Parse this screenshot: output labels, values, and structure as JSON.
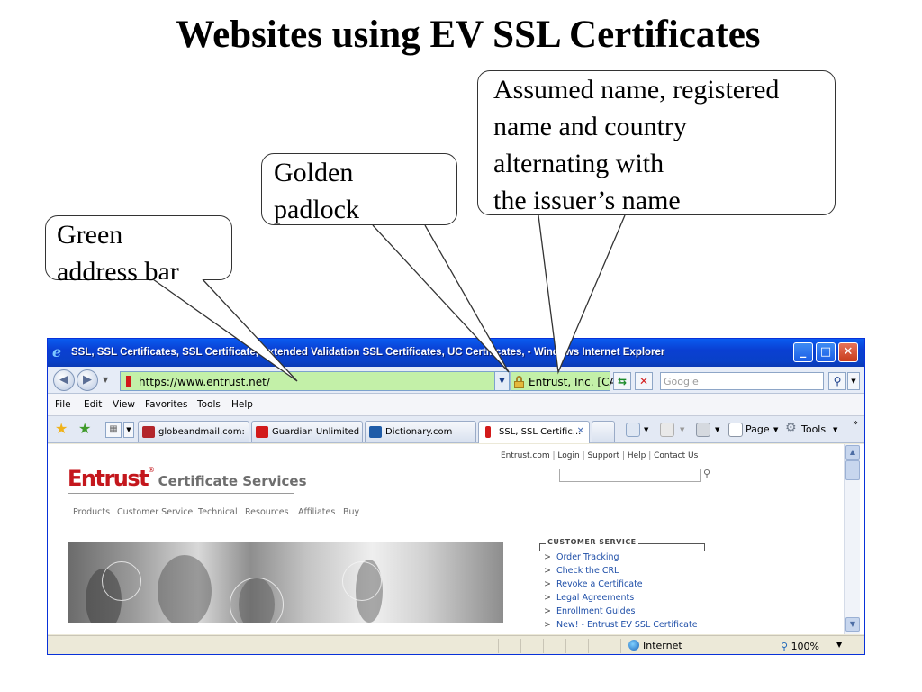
{
  "slide": {
    "title": "Websites using EV SSL Certificates",
    "callouts": {
      "green_address_bar": [
        "Green",
        "address bar"
      ],
      "golden_padlock": [
        "Golden",
        "padlock"
      ],
      "names": [
        "Assumed name, registered",
        "name and country",
        "alternating with",
        "the issuer’s name"
      ]
    }
  },
  "browser": {
    "window_title": "SSL, SSL Certificates, SSL Certificate, Extended Validation SSL Certificates, UC Certificates, - Windows Internet Explorer",
    "address_url": "https://www.entrust.net/",
    "identity_text": "Entrust, Inc. [CA]",
    "search_placeholder": "Google",
    "menu": [
      "File",
      "Edit",
      "View",
      "Favorites",
      "Tools",
      "Help"
    ],
    "tabs": [
      {
        "label": "globeandmail.com: ...",
        "icon_color": "#b3262b"
      },
      {
        "label": "Guardian Unlimited",
        "icon_color": "#d21a1a"
      },
      {
        "label": "Dictionary.com",
        "icon_color": "#1f5ca8"
      },
      {
        "label": "SSL, SSL Certific...",
        "icon_color": "#d21a1a"
      }
    ],
    "commands": {
      "page": "Page",
      "tools": "Tools"
    },
    "status": {
      "zone": "Internet",
      "zoom": "100%"
    },
    "colors": {
      "ev_green": "#c3f0a8",
      "title_blue": "#0a5cf0"
    }
  },
  "page": {
    "top_links": [
      "Entrust.com",
      "Login",
      "Support",
      "Help",
      "Contact Us"
    ],
    "logo_brand": "Entrust",
    "logo_sub": "Certificate Services",
    "nav": [
      "Products",
      "Customer Service",
      "Technical",
      "Resources",
      "Affiliates",
      "Buy"
    ],
    "customer_service": {
      "title": "CUSTOMER SERVICE",
      "items": [
        "Order Tracking",
        "Check the CRL",
        "Revoke a Certificate",
        "Legal Agreements",
        "Enrollment Guides",
        "New! - Entrust EV SSL Certificate"
      ]
    }
  }
}
